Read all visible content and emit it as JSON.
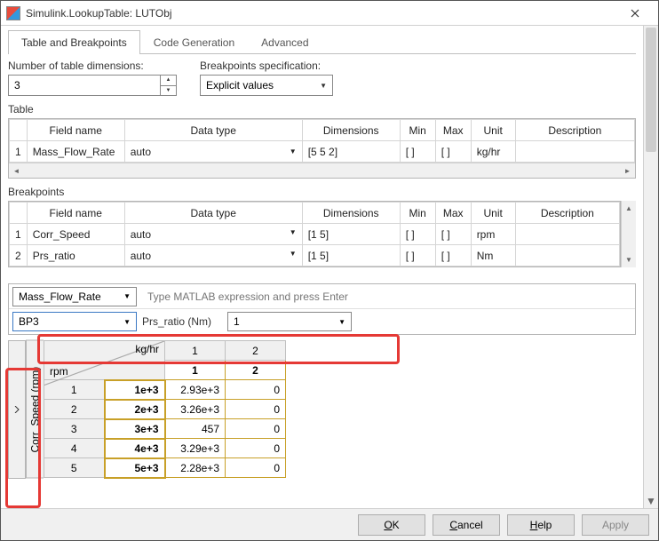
{
  "window": {
    "title": "Simulink.LookupTable: LUTObj"
  },
  "tabs": {
    "t1": "Table and Breakpoints",
    "t2": "Code Generation",
    "t3": "Advanced"
  },
  "controls": {
    "dim_label": "Number of table dimensions:",
    "dim_value": "3",
    "spec_label": "Breakpoints specification:",
    "spec_value": "Explicit values"
  },
  "sections": {
    "table": "Table",
    "breakpoints": "Breakpoints"
  },
  "columns": {
    "field": "Field name",
    "dtype": "Data type",
    "dims": "Dimensions",
    "min": "Min",
    "max": "Max",
    "unit": "Unit",
    "desc": "Description"
  },
  "tableGrid": {
    "row_idx": "1",
    "field": "Mass_Flow_Rate",
    "dtype": "auto",
    "dims": "[5 5 2]",
    "min": "[ ]",
    "max": "[ ]",
    "unit": "kg/hr",
    "desc": ""
  },
  "bpGrid": {
    "r1": {
      "idx": "1",
      "field": "Corr_Speed",
      "dtype": "auto",
      "dims": "[1 5]",
      "min": "[ ]",
      "max": "[ ]",
      "unit": "rpm",
      "desc": ""
    },
    "r2": {
      "idx": "2",
      "field": "Prs_ratio",
      "dtype": "auto",
      "dims": "[1 5]",
      "min": "[ ]",
      "max": "[ ]",
      "unit": "Nm",
      "desc": ""
    }
  },
  "slice": {
    "mflow": "Mass_Flow_Rate",
    "expr_placeholder": "Type MATLAB expression and press Enter",
    "bp": "BP3",
    "ratio_label": "Prs_ratio (Nm)",
    "ratio_val": "1"
  },
  "axis": {
    "vert": "Corr_Speed (rpm)",
    "unit_top": "kg/hr",
    "unit_left": "rpm"
  },
  "dtable": {
    "col_idx": [
      "1",
      "2"
    ],
    "col_hd": [
      "1",
      "2"
    ],
    "rows": [
      {
        "idx": "1",
        "bp": "1e+3",
        "c1": "2.93e+3",
        "c2": "0"
      },
      {
        "idx": "2",
        "bp": "2e+3",
        "c1": "3.26e+3",
        "c2": "0"
      },
      {
        "idx": "3",
        "bp": "3e+3",
        "c1": "457",
        "c2": "0"
      },
      {
        "idx": "4",
        "bp": "4e+3",
        "c1": "3.29e+3",
        "c2": "0"
      },
      {
        "idx": "5",
        "bp": "5e+3",
        "c1": "2.28e+3",
        "c2": "0"
      }
    ]
  },
  "footer": {
    "ok": "OK",
    "cancel": "Cancel",
    "help": "Help",
    "apply": "Apply"
  }
}
